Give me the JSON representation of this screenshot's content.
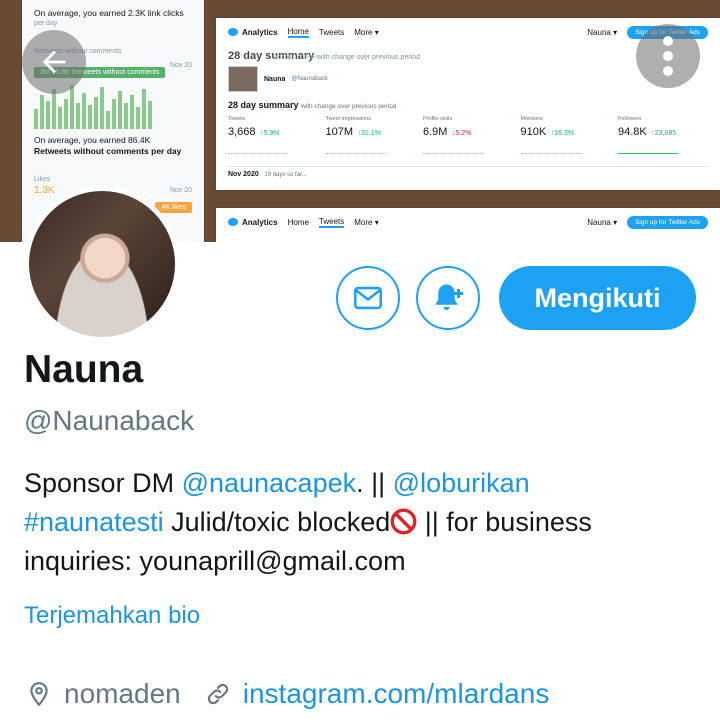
{
  "banner": {
    "left_panel": {
      "line1": "On average, you earned 2.3K link clicks",
      "line1b": "per day",
      "mid_label": "Retweets without comments",
      "tag1_date": "Nov 20",
      "tag1_text": "2M  16.8K Retweets without comments",
      "line2": "On average, you earned 86.4K",
      "line3": "Retweets without comments per day",
      "likes_label": "Likes",
      "likes_value": "1.3K",
      "tag2_date": "Nov 20",
      "tag2_text": "4K likes"
    },
    "analytics": {
      "brand": "Analytics",
      "nav": [
        "Home",
        "Tweets",
        "More ▾"
      ],
      "user_menu": "Nauna ▾",
      "signup": "Sign up for Twitter Ads",
      "ghost_title": "28 day summary",
      "ghost_sub": "with change over previous period",
      "ghost_overlay": "Account home",
      "account_name": "Nauna",
      "account_handle": "@Naunaback",
      "summary_title": "28 day summary",
      "summary_sub": "with change over previous period",
      "stats": [
        {
          "label": "Tweets",
          "value": "3,668",
          "change": "↑5.9%",
          "dir": "up"
        },
        {
          "label": "Tweet impressions",
          "value": "107M",
          "change": "↑31.1%",
          "dir": "up"
        },
        {
          "label": "Profile visits",
          "value": "6.9M",
          "change": "↓5.2%",
          "dir": "down"
        },
        {
          "label": "Mentions",
          "value": "910K",
          "change": "↑16.3%",
          "dir": "up"
        },
        {
          "label": "Followers",
          "value": "94.8K",
          "change": "↑23,685",
          "dir": "up"
        }
      ],
      "period": "Nov 2020",
      "period_sub": "· 19 days so far..."
    },
    "analytics_bottom": {
      "brand": "Analytics",
      "nav": [
        "Home",
        "Tweets",
        "More ▾"
      ],
      "user_menu": "Nauna ▾",
      "signup": "Sign up for Twitter Ads"
    }
  },
  "profile": {
    "name": "Nauna",
    "handle": "@Naunaback",
    "bio": {
      "p1": "Sponsor DM ",
      "mention1": "@naunacapek",
      "p2": ". || ",
      "mention2": "@loburikan",
      "hashtag": "#naunatesti",
      "p3": " Julid/toxic blocked",
      "p4": " || for business inquiries: younaprill@gmail.com"
    },
    "translate_label": "Terjemahkan bio",
    "location": "nomaden",
    "website": "instagram.com/mlardans",
    "follow_label": "Mengikuti"
  },
  "icons": {
    "back": "back-arrow-icon",
    "more": "more-vertical-icon",
    "message": "envelope-icon",
    "notify": "bell-plus-icon",
    "location": "location-pin-icon",
    "link": "link-icon",
    "blocked": "no-entry-icon"
  },
  "colors": {
    "accent": "#1da1f2",
    "link": "#1b95e0",
    "secondary_text": "#657786",
    "primary_text": "#14171a"
  }
}
